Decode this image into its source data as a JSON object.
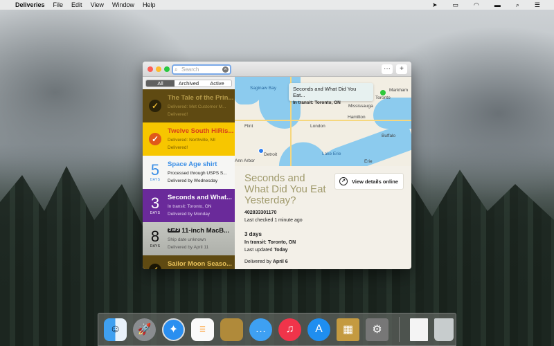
{
  "menubar": {
    "app": "Deliveries",
    "items": [
      "File",
      "Edit",
      "View",
      "Window",
      "Help"
    ]
  },
  "toolbar": {
    "search_placeholder": "Search",
    "more_label": "···",
    "add_label": "+"
  },
  "filter": {
    "tabs": [
      "All",
      "Archived",
      "Active"
    ],
    "selected": "All"
  },
  "deliveries": [
    {
      "title": "The Tale of the Prin...",
      "line1": "Delivered: Met Customer M...",
      "line2": "Delivered!",
      "status": "delivered",
      "color": "#5f4a12"
    },
    {
      "title": "Twelve South HiRis...",
      "line1": "Delivered: Northville, MI",
      "line2": "Delivered!",
      "status": "delivered",
      "color": "#f7c600"
    },
    {
      "days": "5",
      "days_label": "DAYS",
      "title": "Space Age shirt",
      "line1": "Processed through USPS S...",
      "line2": "Delivered by Wednesday",
      "color": "#f6f6f4"
    },
    {
      "days": "3",
      "days_label": "DAYS",
      "title": "Seconds and What...",
      "line1": "In transit: Toronto, ON",
      "line2": "Delivered by Monday",
      "color": "#6a2a9a"
    },
    {
      "days": "8",
      "days_label": "DAYS",
      "badge": "2 of 2",
      "title": "11-inch MacB...",
      "line1": "Ship date unknown",
      "line2": "Delivered by April 11",
      "color": "#b9bbb5"
    },
    {
      "title": "Sailor Moon Seaso...",
      "status": "delivered",
      "color": "#5f4a12"
    }
  ],
  "map": {
    "callout_title": "Seconds and What Did You Eat...",
    "callout_subtitle": "In transit: Toronto, ON",
    "labels": [
      "Saginaw Bay",
      "Markham",
      "Mississauga",
      "Hamilton",
      "Flint",
      "London",
      "Buffalo",
      "Lake Erie",
      "Erie",
      "Detroit",
      "Ann Arbor",
      "Toronto"
    ]
  },
  "detail": {
    "title": "Seconds and What Did You Eat Yesterday?",
    "tracking": "402833301170",
    "checked": "Last checked 1 minute ago",
    "days": "3 days",
    "status_prefix": "In transit:",
    "status_place": "Toronto, ON",
    "updated_prefix": "Last updated",
    "updated": "Today",
    "delivered_prefix": "Delivered by",
    "delivered": "April 6",
    "view_button": "View details online"
  },
  "dock": [
    "Finder",
    "Launchpad",
    "Safari",
    "Reminders",
    "Notefile",
    "Messages",
    "iTunes",
    "App Store",
    "Deliveries",
    "System Preferences",
    "Document",
    "Trash"
  ]
}
